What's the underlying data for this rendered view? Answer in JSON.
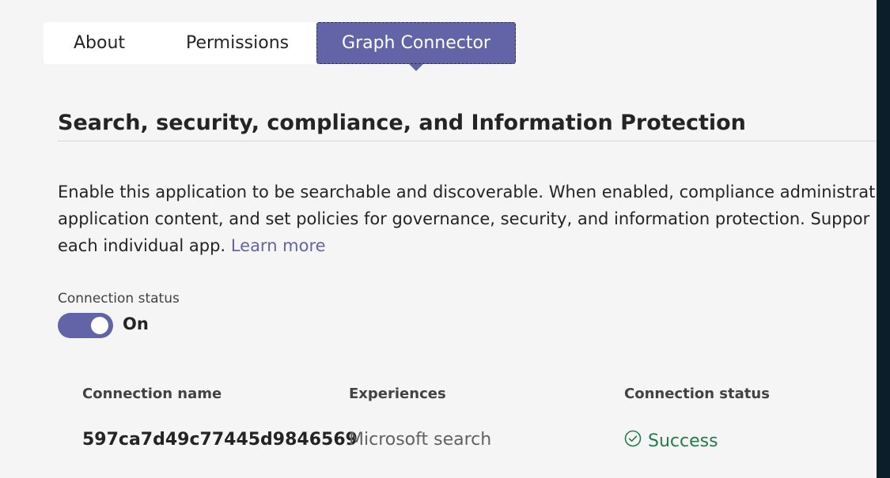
{
  "tabs": [
    {
      "label": "About"
    },
    {
      "label": "Permissions"
    },
    {
      "label": "Graph Connector",
      "selected": true
    }
  ],
  "section": {
    "title": "Search, security, compliance, and Information Protection",
    "description_lines": [
      "Enable this application to be searchable and discoverable. When enabled, compliance administrat",
      "application content, and set policies for governance, security, and information protection. Suppor",
      "each individual app."
    ],
    "learn_more": "Learn more"
  },
  "connection": {
    "label": "Connection status",
    "toggle_state": "On"
  },
  "table": {
    "headers": [
      "Connection name",
      "Experiences",
      "Connection status"
    ],
    "rows": [
      {
        "name": "597ca7d49c77445d9846569",
        "experience": "Microsoft search",
        "status": "Success"
      }
    ]
  },
  "colors": {
    "accent": "#6264a7",
    "success": "#237b4b"
  }
}
